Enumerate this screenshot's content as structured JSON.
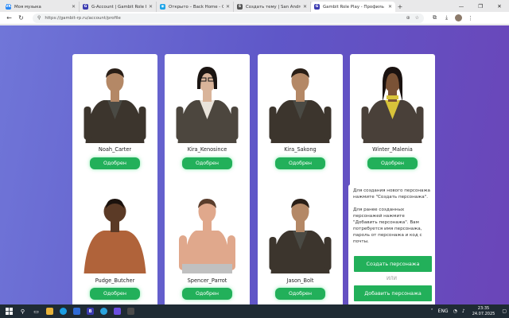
{
  "browser": {
    "tabs": [
      {
        "title": "Моя музыка",
        "favicon": "VK",
        "color": "#2787f5"
      },
      {
        "title": "G-Account | Gambit Role Play",
        "favicon": "G",
        "color": "#3b3bb0"
      },
      {
        "title": "Открыто – Back Home - OOC - Пр…",
        "favicon": "◉",
        "color": "#1aa3e8"
      },
      {
        "title": "Создать тему | San Andreas Emer…",
        "favicon": "S",
        "color": "#555555"
      },
      {
        "title": "Gambit Role Play - Профиль UCP",
        "favicon": "G",
        "color": "#3b3bb0"
      }
    ],
    "new_tab": "+",
    "url": "https://gambit-rp.ru/account/profile",
    "window_controls": [
      "—",
      "❐",
      "✕"
    ]
  },
  "characters": [
    {
      "name": "Noah_Carter",
      "status": "Одобрен",
      "skin": "#b48866",
      "hair": "#2a1f17",
      "top": "#3c352d",
      "shirt": "#4a4a44"
    },
    {
      "name": "Kira_Kenosince",
      "status": "Одобрен",
      "skin": "#d9b49a",
      "hair": "#1b1512",
      "top": "#4c463e",
      "shirt": "#e9e3da"
    },
    {
      "name": "Kira_Sakong",
      "status": "Одобрен",
      "skin": "#b48866",
      "hair": "#2a1f17",
      "top": "#3c352d",
      "shirt": "#4a4a44"
    },
    {
      "name": "Winter_Malenia",
      "status": "Одобрен",
      "skin": "#7a5236",
      "hair": "#1a1210",
      "top": "#494039",
      "shirt": "#d8c33a"
    },
    {
      "name": "Pudge_Butcher",
      "status": "Одобрен",
      "skin": "#5b3a26",
      "hair": "#1b120d",
      "top": "#b0633a",
      "shirt": "#b0633a"
    },
    {
      "name": "Spencer_Parrot",
      "status": "Одобрен",
      "skin": "#e0a88c",
      "hair": "#5a3d2c",
      "top": "#e0a88c",
      "shirt": "#e0a88c"
    },
    {
      "name": "Jason_Bolt",
      "status": "Одобрен",
      "skin": "#b48866",
      "hair": "#2a1f17",
      "top": "#3c352d",
      "shirt": "#4a4a44"
    }
  ],
  "info": {
    "text1": "Для создания нового персонажа нажмите \"Создать персонажа\".",
    "text2": "Для ранее созданных персонажей нажмите \"Добавить персонажа\". Вам потребуется имя персонажа, пароль от персонажа и код с почты.",
    "create_button": "Создать персонажа",
    "or_text": "ИЛИ",
    "add_button": "Добавить персонажа"
  },
  "taskbar": {
    "lang": "ENG",
    "time": "23:35",
    "date": "24.07.2025"
  },
  "colors": {
    "accent_green": "#22b05a",
    "gradient_start": "#7076d8",
    "gradient_end": "#6b45b8"
  }
}
